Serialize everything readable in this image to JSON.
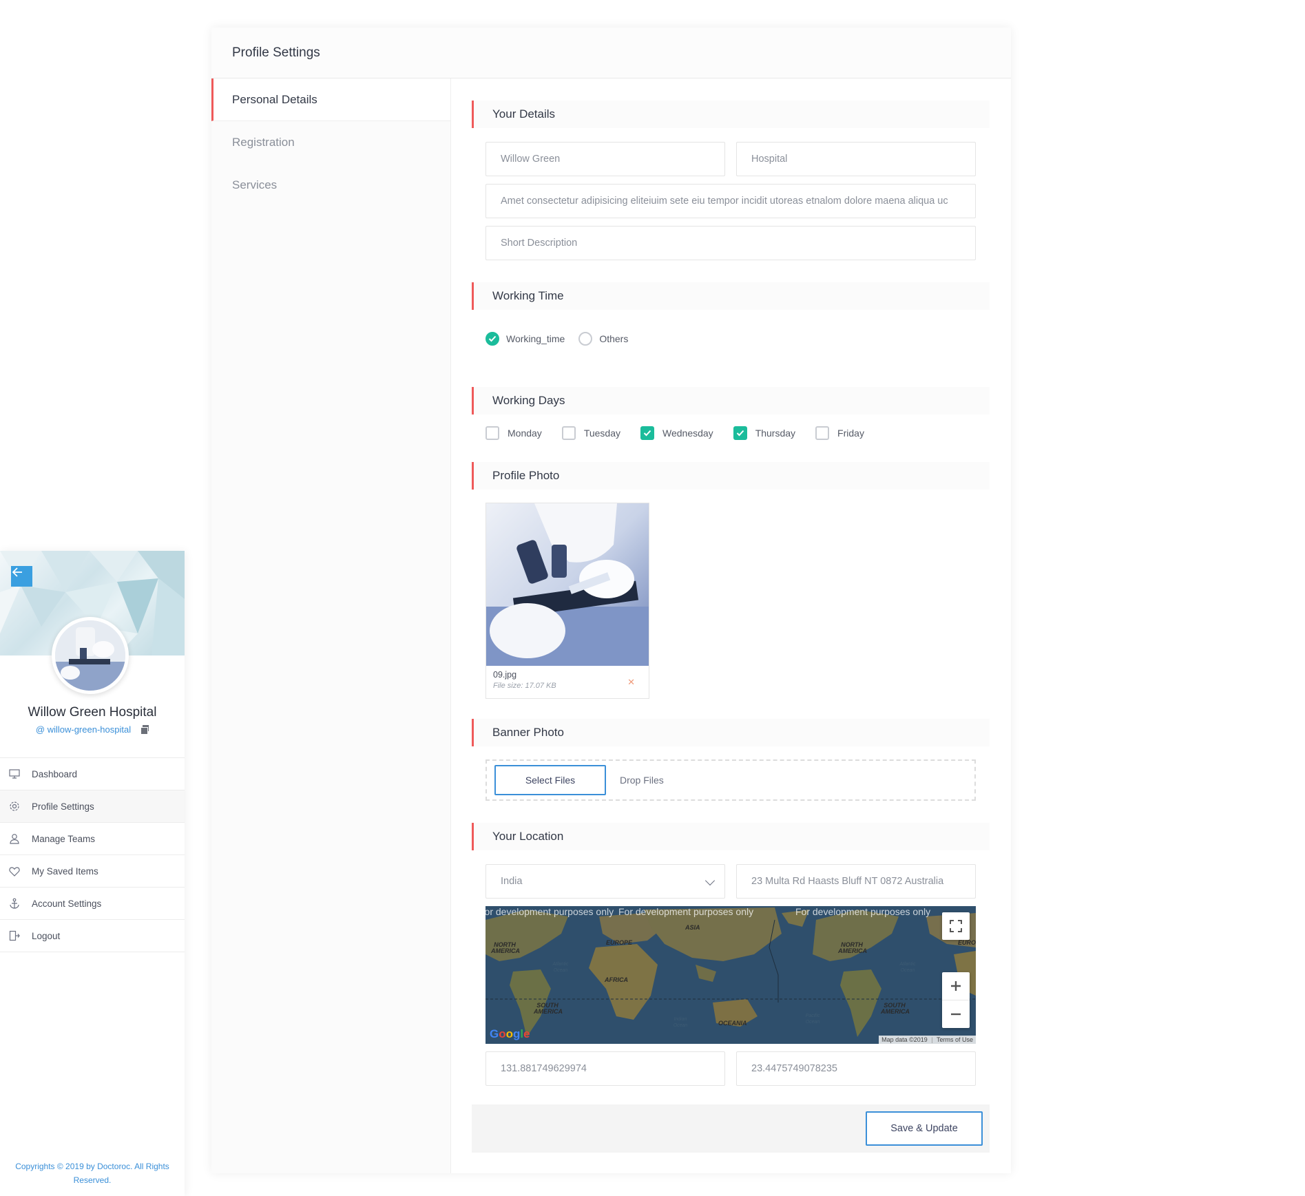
{
  "sidebar": {
    "name": "Willow Green Hospital",
    "handle": "@ willow-green-hospital",
    "menu": [
      {
        "label": "Dashboard",
        "icon": "monitor-icon"
      },
      {
        "label": "Profile Settings",
        "icon": "gear-icon"
      },
      {
        "label": "Manage Teams",
        "icon": "user-icon"
      },
      {
        "label": "My Saved Items",
        "icon": "heart-icon"
      },
      {
        "label": "Account Settings",
        "icon": "anchor-icon"
      },
      {
        "label": "Logout",
        "icon": "logout-icon"
      }
    ],
    "footer": "Copyrights © 2019 by Doctoroc. All Rights Reserved.",
    "accent": "#3a9fe0"
  },
  "card": {
    "title": "Profile Settings",
    "tabs": [
      "Personal Details",
      "Registration",
      "Services"
    ]
  },
  "sections": {
    "your_details": "Your Details",
    "working_time": "Working Time",
    "working_days": "Working Days",
    "profile_photo": "Profile Photo",
    "banner_photo": "Banner Photo",
    "your_location": "Your Location"
  },
  "details": {
    "first_name": "Willow Green",
    "last_name": "Hospital",
    "tagline": "Amet consectetur adipisicing eliteiuim sete eiu tempor incidit utoreas etnalom dolore maena aliqua uc",
    "short_description_placeholder": "Short Description"
  },
  "working_time": {
    "options": [
      {
        "label": "Working_time",
        "checked": true
      },
      {
        "label": "Others",
        "checked": false
      }
    ]
  },
  "working_days": [
    {
      "label": "Monday",
      "checked": false
    },
    {
      "label": "Tuesday",
      "checked": false
    },
    {
      "label": "Wednesday",
      "checked": true
    },
    {
      "label": "Thursday",
      "checked": true
    },
    {
      "label": "Friday",
      "checked": false
    }
  ],
  "profile_photo": {
    "file_name": "09.jpg",
    "file_size": "File size: 17.07 KB"
  },
  "banner_photo": {
    "select_label": "Select Files",
    "drop_label": "Drop Files"
  },
  "location": {
    "country": "India",
    "address": "23 Multa Rd Haasts Bluff NT 0872 Australia",
    "longitude": "131.881749629974",
    "latitude": "23.4475749078235"
  },
  "map": {
    "watermark": "For development purposes only",
    "labels": [
      "NORTH AMERICA",
      "EUROPE",
      "ASIA",
      "AFRICA",
      "SOUTH AMERICA",
      "OCEANIA",
      "Atlantic Ocean",
      "Indian Ocean",
      "Pacific Ocean",
      "NORTH AMERICA",
      "SOUTH AMERICA",
      "Atlantic Ocean",
      "EURO"
    ],
    "attribution": "Map data ©2019",
    "terms": "Terms of Use",
    "google": "Google"
  },
  "actions": {
    "save_label": "Save & Update"
  },
  "colors": {
    "accent_red": "#ef5a5a",
    "check_green": "#1bbc9b",
    "link_blue": "#3a8fd8"
  }
}
